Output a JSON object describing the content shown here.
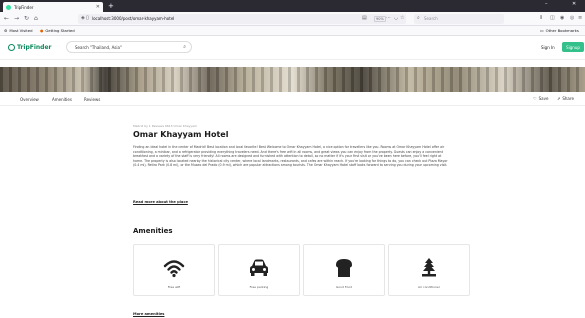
{
  "browser": {
    "tab_title": "TripFinder",
    "url": "localhost:3000/post/omar-khayyam-hotel",
    "zoom": "90%",
    "search_placeholder": "Search",
    "bookmarks": [
      "Most Visited",
      "Getting Started"
    ],
    "other_bookmarks": "Other Bookmarks"
  },
  "header": {
    "logo": "TripFinder",
    "search_value": "Search \"Thailand, Asia\"",
    "signin": "Sign In",
    "join": "Signup"
  },
  "subnav": {
    "links": [
      "Overview",
      "Amenities",
      "Reviews"
    ],
    "save": "Save",
    "share": "Share"
  },
  "hotel": {
    "crumb": "Madrid by 1 Reviews 6615 Omar Khayyam",
    "title": "Omar Khayyam Hotel",
    "description": "Finding an ideal hotel in the center of Madrid! Best location and local favorite! Best Welcome to Omar Khayyam Hotel, a nice option for travellers like you. Rooms at Omar Khayyam Hotel offer air conditioning, a minibar, and a refrigerator providing everything travelers need. And there's free wifi in all rooms, and great views you can enjoy from the property. Guests can enjoy a convenient breakfast and a variety of the staff is very friendly! All rooms are designed and furnished with attention to detail, so no matter if it's your first visit or you've been here before, you'll feel right at home. The property is also located nearby the historical city center, where local landmarks, restaurants, and cafes are within reach. If you're looking for things to do, you can check out Plaza Mayor (0.4 mi), Retiro Park (0.8 mi), or the Museo del Prado (0.9 mi), which are popular attractions among tourists. The Omar Khayyam Hotel staff looks forward to serving you during your upcoming visit.",
    "read_more": "Read more about the place"
  },
  "amenities": {
    "heading": "Amenities",
    "items": [
      {
        "label": "Free wifi",
        "icon": "wifi-icon"
      },
      {
        "label": "Free parking",
        "icon": "car-icon"
      },
      {
        "label": "Good Food",
        "icon": "food-icon"
      },
      {
        "label": "Air conditioner",
        "icon": "ac-icon"
      }
    ],
    "more": "More amenities"
  }
}
